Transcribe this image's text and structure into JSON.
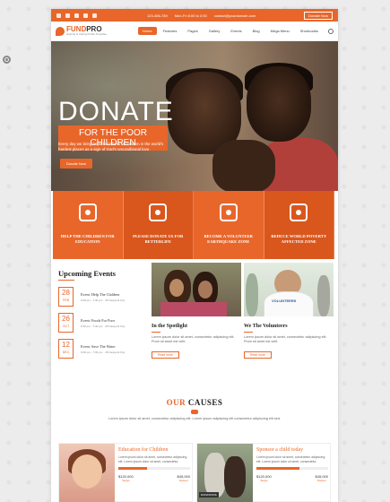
{
  "topbar": {
    "phone": "123-456-789",
    "hours": "Mon-Fri 8:00 to 2:00",
    "email": "contact@yourdomain.com",
    "donate_label": "Donate Now"
  },
  "logo": {
    "name_a": "FUND",
    "name_b": "PRO",
    "tagline": "Helping & Caring Profile Template"
  },
  "nav": [
    {
      "label": "Home"
    },
    {
      "label": "Features"
    },
    {
      "label": "Pages"
    },
    {
      "label": "Gallery"
    },
    {
      "label": "Events"
    },
    {
      "label": "Blog"
    },
    {
      "label": "Mega Menu"
    },
    {
      "label": "Shortcodes"
    }
  ],
  "hero": {
    "title": "DONATE",
    "subtitle": "FOR THE POOR CHILDREN",
    "desc": "Every day we bring hope to millions of children in the world's hardest places as a sign of God's unconditional love.",
    "button": "Donate Now"
  },
  "features": [
    {
      "label": "HELP THE CHILDREN FOR EDUCATION",
      "icon": "heart-hand-icon"
    },
    {
      "label": "PLEASE DONATE US FOR BETTERLIFE",
      "icon": "donation-box-icon"
    },
    {
      "label": "BECOME A VOLUNTEER EARTHQUAKE ZONE",
      "icon": "volunteers-icon"
    },
    {
      "label": "REDUCE WORLD POVERTY AFFECTED ZONE",
      "icon": "hands-care-icon"
    }
  ],
  "events": {
    "title": "Upcoming Events",
    "items": [
      {
        "day": "28",
        "month": "FEB",
        "title": "Event: Help The Children",
        "time": "6:30 pm - 7:30 pm",
        "place": "25 Newyork City"
      },
      {
        "day": "26",
        "month": "OCT",
        "title": "Event: Foods For Poor",
        "time": "6:30 pm - 7:30 pm",
        "place": "25 Newyork City"
      },
      {
        "day": "12",
        "month": "DEC",
        "title": "Event: Save The Water",
        "time": "6:30 pm - 7:30 pm",
        "place": "25 Newyork City"
      }
    ]
  },
  "spotlight": {
    "title": "In the Spotlight",
    "text": "Lorem ipsum dolor sit amet, consectetur adipiscing elit. Proin sit amet est velit.",
    "more": "Read more"
  },
  "volunteers": {
    "title": "We The Volunteers",
    "text": "Lorem ipsum dolor sit amet, consectetur adipiscing elit. Proin sit amet est velit.",
    "more": "Read more",
    "shirt": "VOLUNTEERS"
  },
  "causes": {
    "title_a": "OUR",
    "title_b": "CAUSES",
    "text": "Lorem ipsum dolor sit amet, consectetur adipiscing elit. Lorem ipsum adipiscing elit consectetur adipiscing elit sed."
  },
  "cause_cards": [
    {
      "title": "Education for Children",
      "text": "Lorem ipsum dolor sit amet, consectetur adipiscing elit. Lorem ipsum dolor sit amet, consectetur.",
      "percent": 40,
      "target": "$120,000",
      "target_label": "Target",
      "raised": "$45,000",
      "raised_label": "Raised"
    },
    {
      "title": "Sponsor a child today",
      "text": "Lorem ipsum dolor sit amet, consectetur adipiscing elit. Lorem ipsum dolor sit amet, consectetur.",
      "percent": 60,
      "target": "$120,000",
      "target_label": "Target",
      "raised": "$45,000",
      "raised_label": "Raised",
      "image_label": "DONATIONS"
    }
  ],
  "colors": {
    "accent": "#e8662a"
  }
}
